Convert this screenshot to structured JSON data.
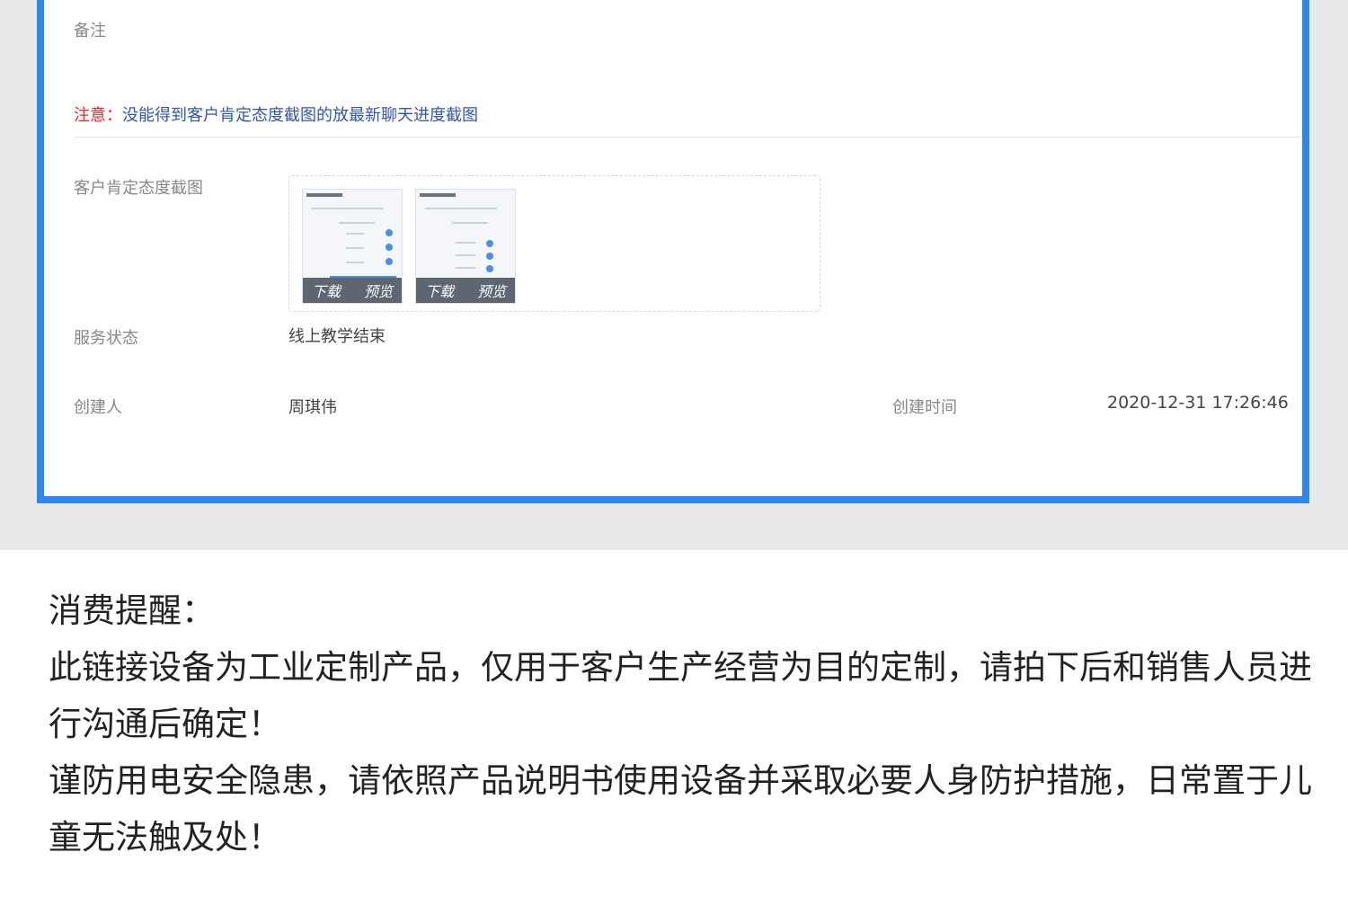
{
  "record": {
    "remark_label": "备注",
    "notice_prefix": "注意：",
    "notice_text": "没能得到客户肯定态度截图的放最新聊天进度截图",
    "screenshot_label": "客户肯定态度截图",
    "thumbnails": [
      {
        "download": "下载",
        "preview": "预览"
      },
      {
        "download": "下载",
        "preview": "预览"
      }
    ],
    "status_label": "服务状态",
    "status_value": "线上教学结束",
    "creator_label": "创建人",
    "creator_value": "周琪伟",
    "created_time_label": "创建时间",
    "created_time_value": "2020-12-31 17:26:46"
  },
  "reminder": {
    "title": "消费提醒：",
    "paragraph1": "此链接设备为工业定制产品，仅用于客户生产经营为目的定制，请拍下后和销售人员进行沟通后确定！",
    "paragraph2": "谨防用电安全隐患，请依照产品说明书使用设备并采取必要人身防护措施，日常置于儿童无法触及处！"
  },
  "colors": {
    "panel_border": "#2f86ee",
    "warn": "#e8262b",
    "notice": "#3355aa"
  }
}
